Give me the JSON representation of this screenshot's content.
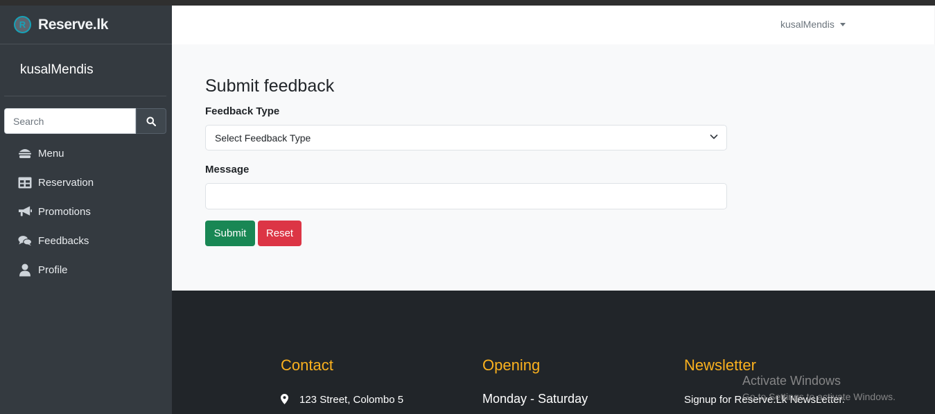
{
  "brand": {
    "logo_letter": "R",
    "name": "Reserve.lk"
  },
  "sidebar": {
    "user_name": "kusalMendis",
    "search": {
      "placeholder": "Search"
    },
    "items": [
      {
        "label": "Menu",
        "icon": "hamburger-food-icon"
      },
      {
        "label": "Reservation",
        "icon": "table-grid-icon"
      },
      {
        "label": "Promotions",
        "icon": "megaphone-icon"
      },
      {
        "label": "Feedbacks",
        "icon": "comments-icon"
      },
      {
        "label": "Profile",
        "icon": "user-icon"
      }
    ]
  },
  "topbar": {
    "user_menu": "kusalMendis"
  },
  "form": {
    "title": "Submit feedback",
    "feedback_type_label": "Feedback Type",
    "feedback_type_value": "Select Feedback Type",
    "message_label": "Message",
    "message_value": "",
    "submit_label": "Submit",
    "reset_label": "Reset"
  },
  "footer": {
    "contact_title": "Contact",
    "address": "123 Street, Colombo 5",
    "opening_title": "Opening",
    "opening_days": "Monday - Saturday",
    "newsletter_title": "Newsletter",
    "newsletter_text": "Signup for Reserve.Lk NewsLetter."
  },
  "watermark": {
    "line1": "Activate Windows",
    "line2": "Go to Settings to activate Windows."
  },
  "colors": {
    "sidebar_bg": "#343a40",
    "footer_bg": "#212529",
    "accent_yellow": "#fbb11e",
    "submit_green": "#198754",
    "reset_red": "#dc3545",
    "brand_teal": "#17a2b8"
  }
}
